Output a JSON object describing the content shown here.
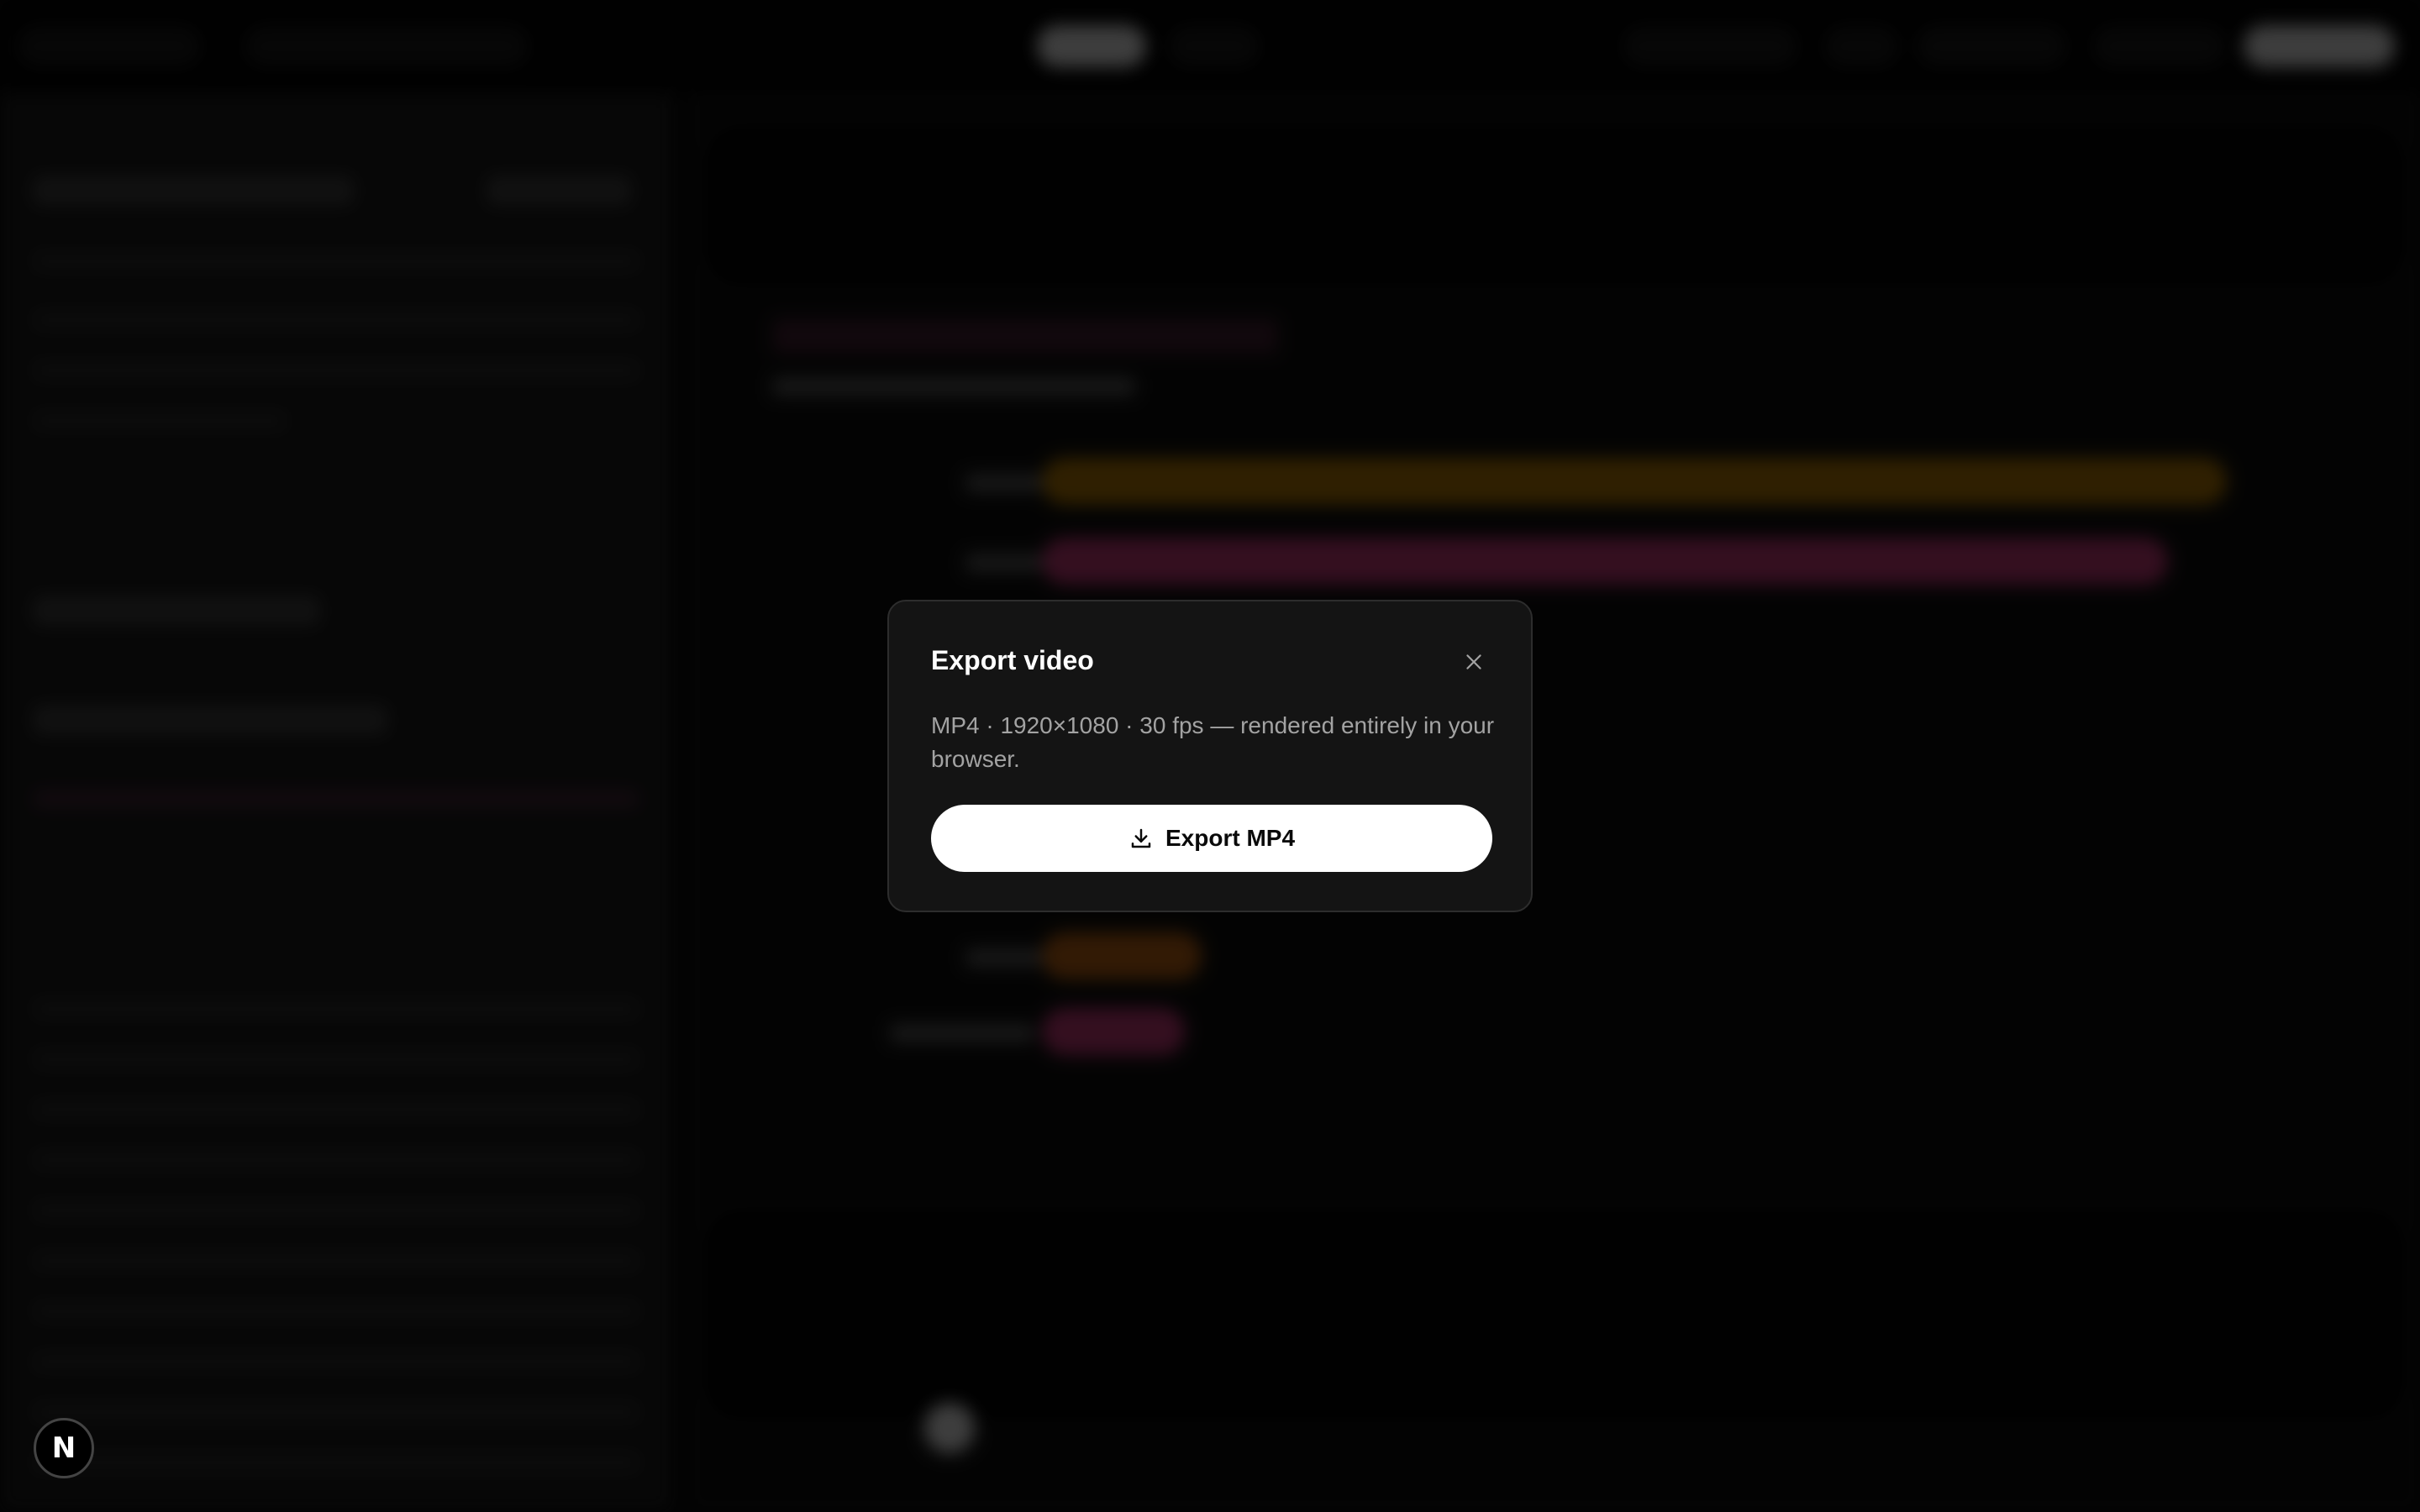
{
  "dialog": {
    "title": "Export video",
    "description": "MP4 · 1920×1080 · 30 fps — rendered entirely in your browser.",
    "export_label": "Export MP4",
    "close_icon": "close-icon",
    "download_icon": "download-icon"
  },
  "fab": {
    "letter": "N",
    "icon": "nextjs-logo-icon"
  },
  "colors": {
    "dialog_bg": "#141414",
    "dialog_border": "#2d2d2d",
    "button_bg": "#ffffff",
    "bar_gold": "#a06a00",
    "bar_pink": "#b0306a",
    "bar_orange": "#a8560e"
  }
}
